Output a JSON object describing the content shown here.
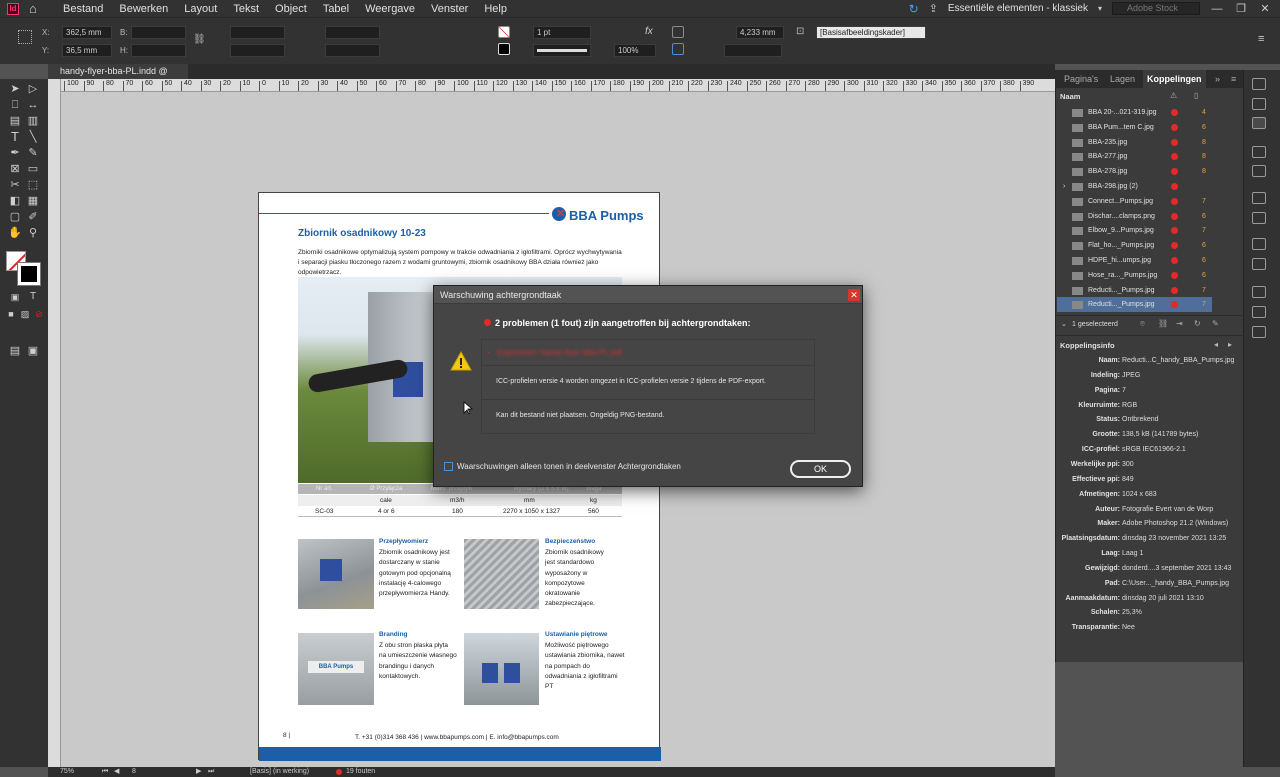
{
  "menubar": {
    "logo": "Id",
    "items": [
      "Bestand",
      "Bewerken",
      "Layout",
      "Tekst",
      "Object",
      "Tabel",
      "Weergave",
      "Venster",
      "Help"
    ],
    "workspace": "Essentiële elementen - klassiek",
    "search_placeholder": "Adobe Stock"
  },
  "controlbar": {
    "x_label": "X:",
    "x_value": "362,5 mm",
    "y_label": "Y:",
    "y_value": "36,5 mm",
    "b_label": "B:",
    "h_label": "H:",
    "stroke_weight": "1 pt",
    "zoom": "100%",
    "dimension": "4,233 mm",
    "object_style": "[Basisafbeeldingskader]"
  },
  "document": {
    "tab_name": "handy-flyer-bba-PL.indd @ 75%",
    "ruler_ticks": [
      "100",
      "90",
      "80",
      "70",
      "60",
      "50",
      "40",
      "30",
      "20",
      "10",
      "0",
      "10",
      "20",
      "30",
      "40",
      "50",
      "60",
      "70",
      "80",
      "90",
      "100",
      "110",
      "120",
      "130",
      "140",
      "150",
      "160",
      "170",
      "180",
      "190",
      "200",
      "210",
      "220",
      "230",
      "240",
      "250",
      "260",
      "270",
      "280",
      "290",
      "300",
      "310",
      "320",
      "330",
      "340",
      "350",
      "360",
      "370",
      "380",
      "390"
    ]
  },
  "page": {
    "brand": "BBA Pumps",
    "title": "Zbiornik osadnikowy 10-23",
    "intro": "Zbiorniki osadnikowe optymalizują system pompowy w trakcie odwadniania z igłofiltrami. Oprócz wychwytywania i separacji piasku tłoczonego razem z wodami gruntowymi, zbiornik osadnikowy BBA działa również jako odpowietrzacz.",
    "table_header_faded": [
      "Nr art.",
      "Ø Przyłącza",
      "Maks. przepływ",
      "Wymiary (D x S x W)",
      "Waga"
    ],
    "table_units": [
      "",
      "cale",
      "m3/h",
      "mm",
      "kg"
    ],
    "table_row": [
      "SC-03",
      "4 or 6",
      "180",
      "2270 x 1050 x 1327",
      "560"
    ],
    "features": [
      {
        "title": "Przepływomierz",
        "text": "Zbiornik osadnikowy jest dostarczany w stanie gotowym pod opcjonalną instalację 4-calowego przepływomierza Handy."
      },
      {
        "title": "Bezpieczeństwo",
        "text": "Zbiornik osadnikowy jest standardowo wyposażony w kompozytowe okratowanie zabezpieczające."
      },
      {
        "title": "Branding",
        "text": "Z obu stron płaska płyta na umieszczenie własnego brandingu i danych kontaktowych."
      },
      {
        "title": "Ustawianie piętrowe",
        "text": "Możliwość piętrowego ustawiania zbiornika, nawet na pompach do odwadniania z igłofiltrami PT"
      }
    ],
    "page_number": "8 |",
    "footer": "T. +31 (0)314 368 436 | www.bbapumps.com | E. info@bbapumps.com",
    "brand_colors": {
      "blue": "#1b5fa8",
      "red": "#e53935"
    }
  },
  "dialog": {
    "title": "Warschuwing achtergrondtaak",
    "heading": "2 problemen (1 fout) zijn aangetroffen bij achtergrondtaken:",
    "faded_line": "Exporteren: handy-flyer-bba-PL.pdf",
    "message1": "ICC-profielen versie 4 worden omgezet in ICC-profielen versie 2 tijdens de PDF-export.",
    "message2": "Kan dit bestand niet plaatsen. Ongeldig PNG-bestand.",
    "checkbox_label": "Waarschuwingen alleen tonen in deelvenster Achtergrondtaken",
    "ok_label": "OK"
  },
  "panel": {
    "tabs": [
      "Pagina's",
      "Lagen",
      "Koppelingen"
    ],
    "column_name": "Naam",
    "links": [
      {
        "name": "BBA 20-...021-319.jpg",
        "page": "4"
      },
      {
        "name": "BBA Pum...tem C.jpg",
        "page": "6"
      },
      {
        "name": "BBA-235.jpg",
        "page": "8"
      },
      {
        "name": "BBA-277.jpg",
        "page": "8"
      },
      {
        "name": "BBA-278.jpg",
        "page": "8"
      },
      {
        "name": "BBA-298.jpg (2)",
        "page": ""
      },
      {
        "name": "Connect...Pumps.jpg",
        "page": "7"
      },
      {
        "name": "Dischar....clamps.png",
        "page": "6"
      },
      {
        "name": "Elbow_9...Pumps.jpg",
        "page": "7"
      },
      {
        "name": "Flat_ho..._Pumps.jpg",
        "page": "6"
      },
      {
        "name": "HDPE_hi...umps.jpg",
        "page": "6"
      },
      {
        "name": "Hose_ra..._Pumps.jpg",
        "page": "6"
      },
      {
        "name": "Reducti..._Pumps.jpg",
        "page": "7"
      },
      {
        "name": "Reducti..._Pumps.jpg",
        "page": "7"
      }
    ],
    "selected_count": "1 geselecteerd",
    "info_title": "Koppelingsinfo",
    "info": [
      {
        "k": "Naam:",
        "v": "Reducti...C_handy_BBA_Pumps.jpg"
      },
      {
        "k": "Indeling:",
        "v": "JPEG"
      },
      {
        "k": "Pagina:",
        "v": "7"
      },
      {
        "k": "Kleurruimte:",
        "v": "RGB"
      },
      {
        "k": "Status:",
        "v": "Ontbrekend"
      },
      {
        "k": "Grootte:",
        "v": "138,5 kB (141789 bytes)"
      },
      {
        "k": "ICC-profiel:",
        "v": "sRGB IEC61966-2.1"
      },
      {
        "k": "Werkelijke ppi:",
        "v": "300"
      },
      {
        "k": "Effectieve ppi:",
        "v": "849"
      },
      {
        "k": "Afmetingen:",
        "v": "1024 x 683"
      },
      {
        "k": "Auteur:",
        "v": "Fotografie Evert van de Worp"
      },
      {
        "k": "Maker:",
        "v": "Adobe Photoshop 21.2 (Windows)"
      },
      {
        "k": "Plaatsingsdatum:",
        "v": "dinsdag 23 november 2021 13:25"
      },
      {
        "k": "Laag:",
        "v": "Laag 1"
      },
      {
        "k": "Gewijzigd:",
        "v": "donderd....3 september 2021 13:43"
      },
      {
        "k": "Pad:",
        "v": "C:\\User..._handy_BBA_Pumps.jpg"
      },
      {
        "k": "Aanmaakdatum:",
        "v": "dinsdag 20 juli 2021 13:10"
      },
      {
        "k": "Schalen:",
        "v": "25,3%"
      },
      {
        "k": "Transparantie:",
        "v": "Nee"
      }
    ]
  },
  "statusbar": {
    "zoom": "75%",
    "page": "8",
    "profile": "[Basis] (in werking)",
    "errors": "19 fouten"
  }
}
